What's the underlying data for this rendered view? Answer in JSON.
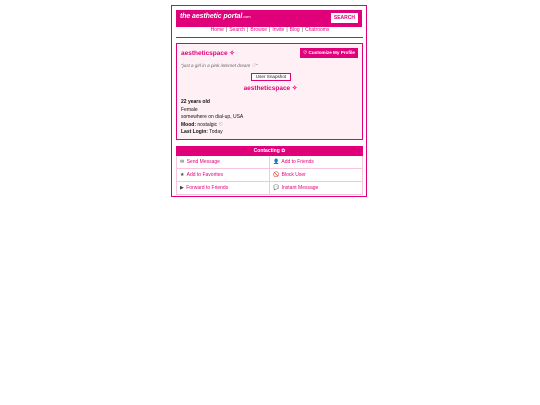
{
  "header": {
    "logo_main": "the aesthetic portal",
    "logo_suffix": ".com",
    "search_label": "SEARCH"
  },
  "nav": {
    "items": [
      "Home",
      "Search",
      "Browse",
      "Invite",
      "Blog",
      "Chatrooms"
    ],
    "separator": "|"
  },
  "profile": {
    "name": "aestheticspace ✧",
    "customize_label": "♡ Customize My Profile",
    "tagline": "\"just a girl in a pink internet dream ♡\"",
    "snapshot_alt": "User Snapshot",
    "center_name": "aestheticspace ✧",
    "age": "22 years old",
    "gender": "Female",
    "location": "somewhere on dial-up, USA",
    "mood_label": "Mood:",
    "mood_value": "nostalgic ♡",
    "last_login_label": "Last Login:",
    "last_login_value": "Today"
  },
  "contacting": {
    "title": "Contacting ✿",
    "actions": [
      {
        "icon": "✉",
        "label": "Send Message"
      },
      {
        "icon": "👤",
        "label": "Add to Friends"
      },
      {
        "icon": "★",
        "label": "Add to Favorites"
      },
      {
        "icon": "🚫",
        "label": "Block User"
      },
      {
        "icon": "▶",
        "label": "Forward to Friends"
      },
      {
        "icon": "💬",
        "label": "Instant Message"
      }
    ]
  },
  "colors": {
    "accent": "#e0007a",
    "panel_bg": "#fff0f6",
    "grid_line": "#f5c6dd"
  }
}
